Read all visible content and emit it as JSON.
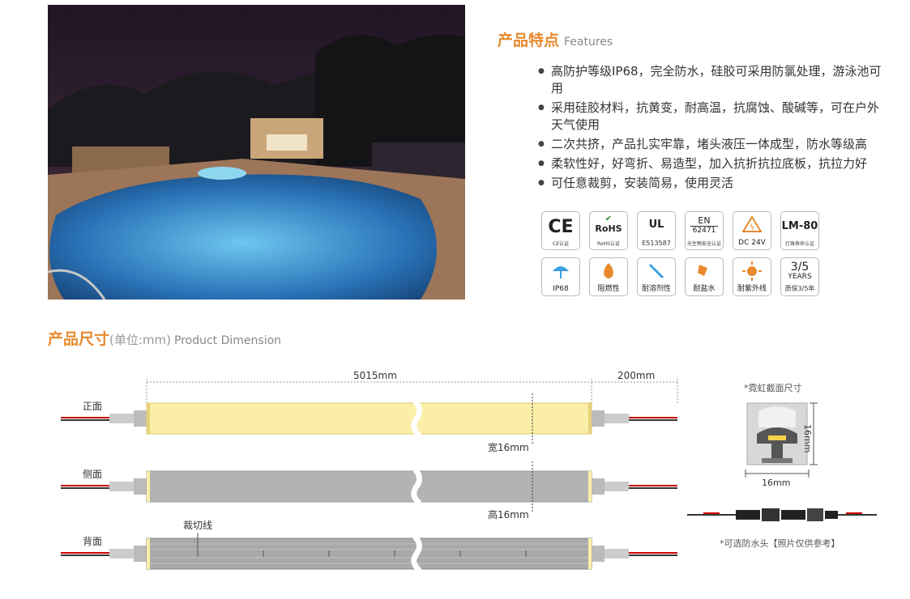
{
  "photo": {
    "alt": "pool"
  },
  "features": {
    "title": "产品特点",
    "title_en": "Features",
    "items": [
      "高防护等级IP68，完全防水，硅胶可采用防氯处理，游泳池可用",
      "采用硅胶材料，抗黄变，耐高温，抗腐蚀、酸碱等，可在户外天气使用",
      "二次共挤，产品扎实牢靠，堵头液压一体成型，防水等级高",
      "柔软性好，好弯折、易造型，加入抗折抗拉底板，抗拉力好",
      "可任意裁剪，安装简易，使用灵活"
    ]
  },
  "certs": {
    "ce": {
      "mark": "CE",
      "caption": "CE认证"
    },
    "rohs": {
      "mark": "RoHS",
      "caption": "RoHS认证"
    },
    "ul": {
      "mark": "UL",
      "caption": "E513587"
    },
    "en": {
      "mark": "EN",
      "num": "62471",
      "caption": "光生物安全认证"
    },
    "dc": {
      "caption": "DC 24V"
    },
    "lm": {
      "mark": "LM-80",
      "caption": "灯珠寿命认证"
    },
    "ip68": {
      "caption": "IP68"
    },
    "flame": {
      "caption": "阻燃性"
    },
    "solvent": {
      "caption": "耐溶剂性"
    },
    "salt": {
      "caption": "耐盐水"
    },
    "uv": {
      "caption": "耐紫外线"
    },
    "warranty": {
      "mark": "3/5",
      "years": "YEARS",
      "caption": "质保3/5年"
    }
  },
  "dimension": {
    "title": "产品尺寸",
    "unit": "(单位:mm)",
    "title_en": "Product Dimension",
    "length_label": "5015mm",
    "lead_label": "200mm",
    "front_label": "正面",
    "side_label": "侧面",
    "back_label": "背面",
    "width_label": "宽16mm",
    "height_label": "高16mm",
    "cut_label": "裁切线",
    "section_title": "*霓虹截面尺寸",
    "section_w": "16mm",
    "section_h": "16mm",
    "connector_note": "*可选防水头【照片仅供参考】"
  },
  "colors": {
    "accent": "#e8892e",
    "strip_front": "#fbeea8",
    "strip_side": "#b3b3b3"
  }
}
